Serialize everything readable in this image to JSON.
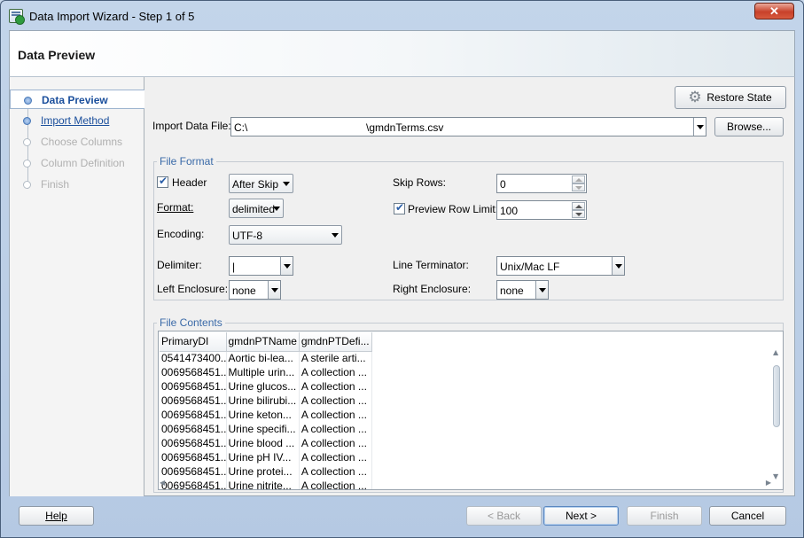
{
  "window": {
    "title": "Data Import Wizard - Step 1 of 5",
    "close_glyph": "✕"
  },
  "header": {
    "title": "Data Preview"
  },
  "nav": {
    "items": [
      {
        "label": "Data Preview",
        "state": "active"
      },
      {
        "label": "Import Method",
        "state": "done"
      },
      {
        "label": "Choose Columns",
        "state": "disabled"
      },
      {
        "label": "Column Definition",
        "state": "disabled"
      },
      {
        "label": "Finish",
        "state": "disabled"
      }
    ]
  },
  "toolbar": {
    "restore_label": "Restore State"
  },
  "import_file": {
    "label": "Import Data File:",
    "path_start": "C:\\",
    "path_end": "\\gmdnTerms.csv",
    "browse_label": "Browse..."
  },
  "file_format": {
    "title": "File Format",
    "header_label": "Header",
    "header_checked": true,
    "header_option": "After Skip",
    "format_label": "Format:",
    "format_value": "delimited",
    "encoding_label": "Encoding:",
    "encoding_value": "UTF-8",
    "delimiter_label": "Delimiter:",
    "delimiter_value": "|",
    "left_enclosure_label": "Left Enclosure:",
    "left_enclosure_value": "none",
    "skip_rows_label": "Skip Rows:",
    "skip_rows_value": "0",
    "preview_limit_label": "Preview Row Limit:",
    "preview_limit_checked": true,
    "preview_limit_value": "100",
    "line_terminator_label": "Line Terminator:",
    "line_terminator_value": "Unix/Mac LF",
    "right_enclosure_label": "Right Enclosure:",
    "right_enclosure_value": "none"
  },
  "file_contents": {
    "title": "File Contents",
    "columns": [
      "PrimaryDI",
      "gmdnPTName",
      "gmdnPTDefi..."
    ],
    "rows": [
      [
        "0541473400...",
        "Aortic bi-lea...",
        "A sterile arti..."
      ],
      [
        "0069568451...",
        "Multiple urin...",
        "A collection ..."
      ],
      [
        "0069568451...",
        "Urine glucos...",
        "A collection ..."
      ],
      [
        "0069568451...",
        "Urine bilirubi...",
        "A collection ..."
      ],
      [
        "0069568451...",
        "Urine keton...",
        "A collection ..."
      ],
      [
        "0069568451...",
        "Urine specifi...",
        "A collection ..."
      ],
      [
        "0069568451...",
        "Urine blood ...",
        "A collection ..."
      ],
      [
        "0069568451...",
        "Urine pH IV...",
        "A collection ..."
      ],
      [
        "0069568451...",
        "Urine protei...",
        "A collection ..."
      ],
      [
        "0069568451...",
        "Urine nitrite...",
        "A collection ..."
      ]
    ]
  },
  "footer": {
    "help_label": "Help",
    "back_label": "< Back",
    "next_label": "Next >",
    "finish_label": "Finish",
    "cancel_label": "Cancel"
  },
  "icons": {
    "restore": "gear-icon",
    "check": "check-icon"
  },
  "colors": {
    "accent": "#1b4f9c",
    "group_title": "#3a6aa8",
    "close": "#c8412a"
  }
}
